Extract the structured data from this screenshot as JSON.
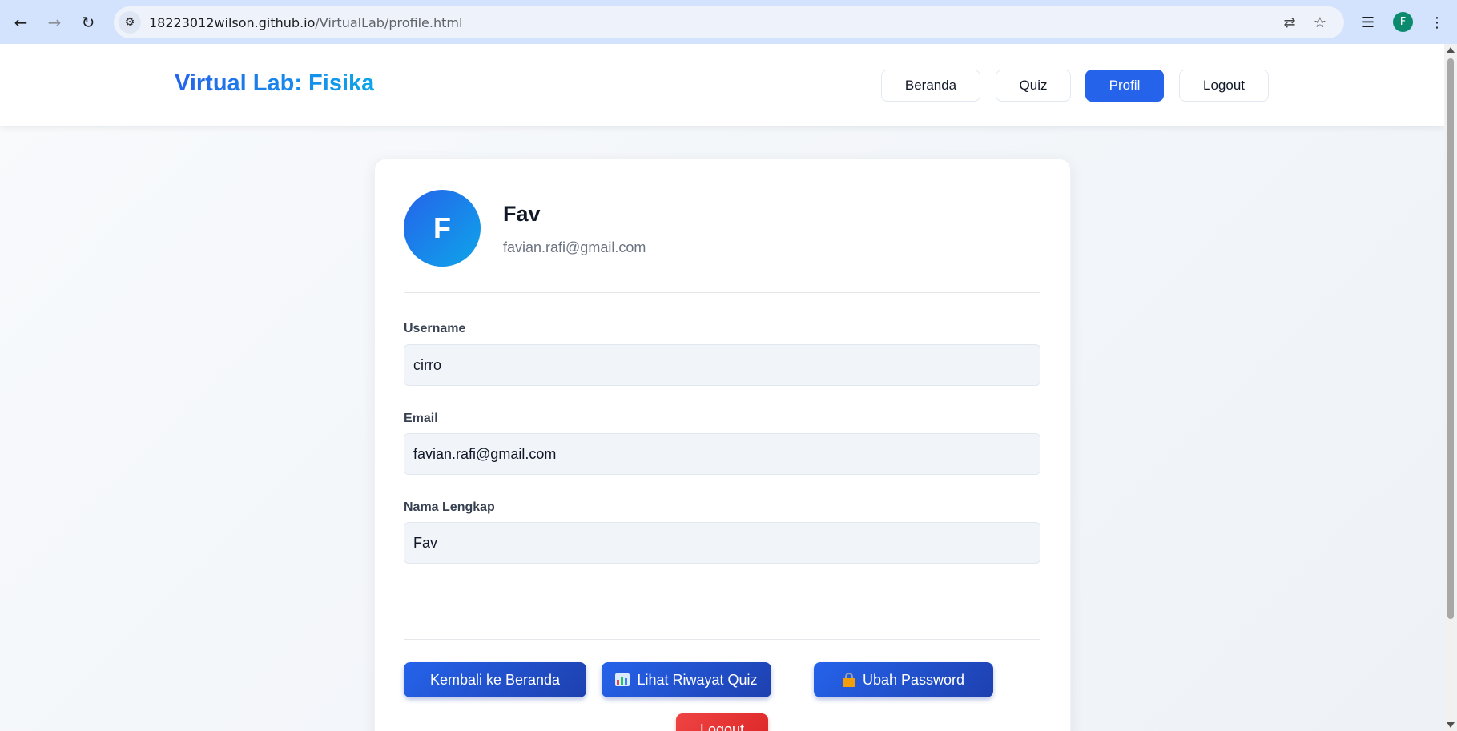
{
  "browser": {
    "url_host": "18223012wilson.github.io",
    "url_path": "/VirtualLab/profile.html",
    "back_icon": "arrow-left-icon",
    "forward_icon": "arrow-right-icon",
    "reload_icon": "reload-icon",
    "profile_initial": "F"
  },
  "header": {
    "title": "Virtual Lab: Fisika",
    "nav": [
      {
        "label": "Beranda",
        "active": false
      },
      {
        "label": "Quiz",
        "active": false
      },
      {
        "label": "Profil",
        "active": true
      },
      {
        "label": "Logout",
        "active": false
      }
    ]
  },
  "profile": {
    "avatar_initial": "F",
    "name": "Fav",
    "email": "favian.rafi@gmail.com"
  },
  "form": {
    "username_label": "Username",
    "username_value": "cirro",
    "email_label": "Email",
    "email_value": "favian.rafi@gmail.com",
    "fullname_label": "Nama Lengkap",
    "fullname_value": "Fav"
  },
  "actions": {
    "back_home": "Kembali ke Beranda",
    "quiz_history": "Lihat Riwayat Quiz",
    "change_password": "Ubah Password",
    "logout": "Logout"
  },
  "colors": {
    "accent": "#2563eb",
    "danger": "#ef4444",
    "title_gradient_start": "#2563eb",
    "title_gradient_end": "#0ea5e9"
  }
}
